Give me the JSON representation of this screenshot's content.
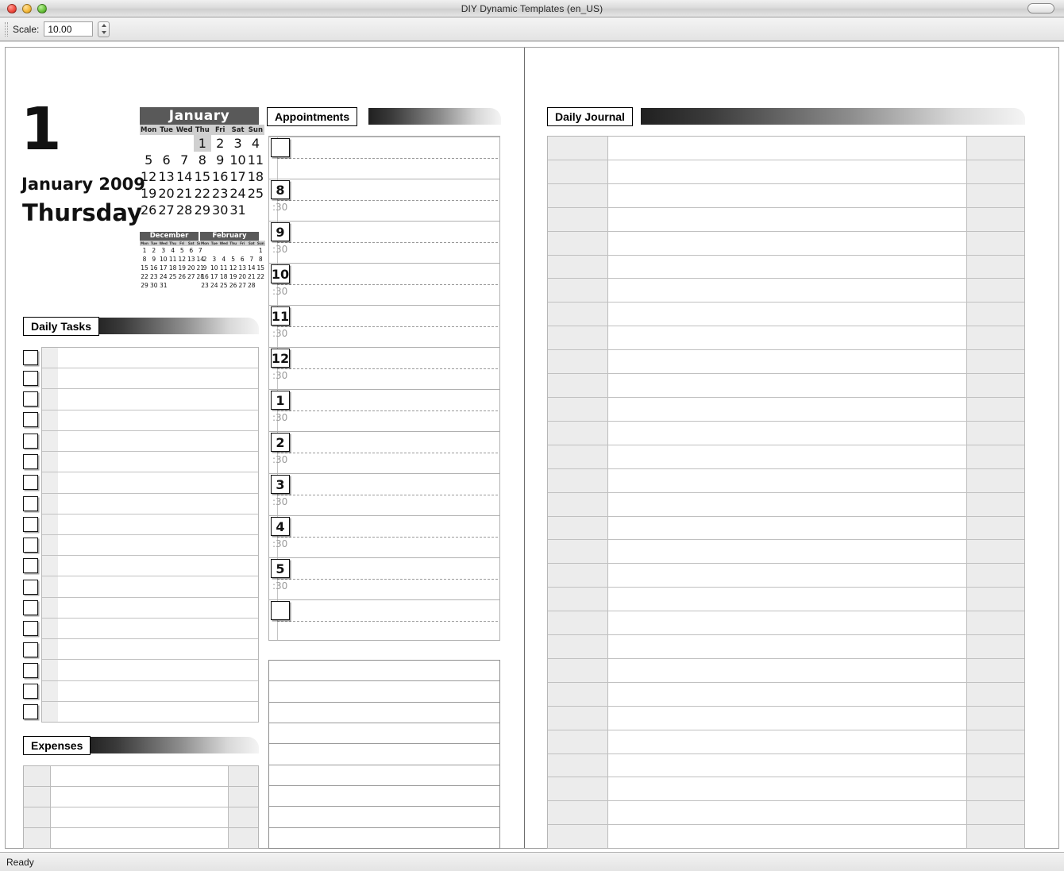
{
  "window": {
    "title": "DIY Dynamic Templates (en_US)",
    "traffic_lights": [
      "close-button",
      "minimize-button",
      "zoom-button"
    ],
    "toolbar_toggle": "toolbar-toggle-button"
  },
  "toolbar": {
    "scale_label": "Scale:",
    "scale_value": "10.00",
    "stepper": "scale-stepper"
  },
  "statusbar": {
    "text": "Ready"
  },
  "date_block": {
    "day_number": "1",
    "month_year": "January 2009",
    "weekday": "Thursday"
  },
  "calendar_main": {
    "title": "January",
    "weekdays": [
      "Mon",
      "Tue",
      "Wed",
      "Thu",
      "Fri",
      "Sat",
      "Sun"
    ],
    "highlight_day": "1",
    "weeks": [
      [
        "",
        "",
        "",
        "1",
        "2",
        "3",
        "4"
      ],
      [
        "5",
        "6",
        "7",
        "8",
        "9",
        "10",
        "11"
      ],
      [
        "12",
        "13",
        "14",
        "15",
        "16",
        "17",
        "18"
      ],
      [
        "19",
        "20",
        "21",
        "22",
        "23",
        "24",
        "25"
      ],
      [
        "26",
        "27",
        "28",
        "29",
        "30",
        "31",
        ""
      ]
    ]
  },
  "calendar_prev": {
    "title": "December",
    "weekdays": [
      "Mon",
      "Tue",
      "Wed",
      "Thu",
      "Fri",
      "Sat",
      "Sun"
    ],
    "weeks": [
      [
        "1",
        "2",
        "3",
        "4",
        "5",
        "6",
        "7"
      ],
      [
        "8",
        "9",
        "10",
        "11",
        "12",
        "13",
        "14"
      ],
      [
        "15",
        "16",
        "17",
        "18",
        "19",
        "20",
        "21"
      ],
      [
        "22",
        "23",
        "24",
        "25",
        "26",
        "27",
        "28"
      ],
      [
        "29",
        "30",
        "31",
        "",
        "",
        "",
        ""
      ]
    ]
  },
  "calendar_next": {
    "title": "February",
    "weekdays": [
      "Mon",
      "Tue",
      "Wed",
      "Thu",
      "Fri",
      "Sat",
      "Sun"
    ],
    "weeks": [
      [
        "",
        "",
        "",
        "",
        "",
        "",
        "1"
      ],
      [
        "2",
        "3",
        "4",
        "5",
        "6",
        "7",
        "8"
      ],
      [
        "9",
        "10",
        "11",
        "12",
        "13",
        "14",
        "15"
      ],
      [
        "16",
        "17",
        "18",
        "19",
        "20",
        "21",
        "22"
      ],
      [
        "23",
        "24",
        "25",
        "26",
        "27",
        "28",
        ""
      ]
    ]
  },
  "sections": {
    "daily_tasks": {
      "label": "Daily Tasks",
      "row_count": 18,
      "checkbox_count": 18
    },
    "expenses": {
      "label": "Expenses",
      "row_count": 4
    },
    "appointments": {
      "label": "Appointments",
      "half_hour_label": ":30",
      "hours": [
        "",
        "8",
        "9",
        "10",
        "11",
        "12",
        "1",
        "2",
        "3",
        "4",
        "5",
        ""
      ],
      "notes_row_count": 9
    },
    "daily_journal": {
      "label": "Daily Journal",
      "row_count": 30
    }
  },
  "colors": {
    "header_bar_dark": "#202020",
    "calendar_title_bg": "#595959",
    "calendar_weekday_bg": "#cfcfcf",
    "highlight_bg": "#d0d0d0",
    "table_shade": "#ececec",
    "rule_line": "#bcbcbc"
  }
}
